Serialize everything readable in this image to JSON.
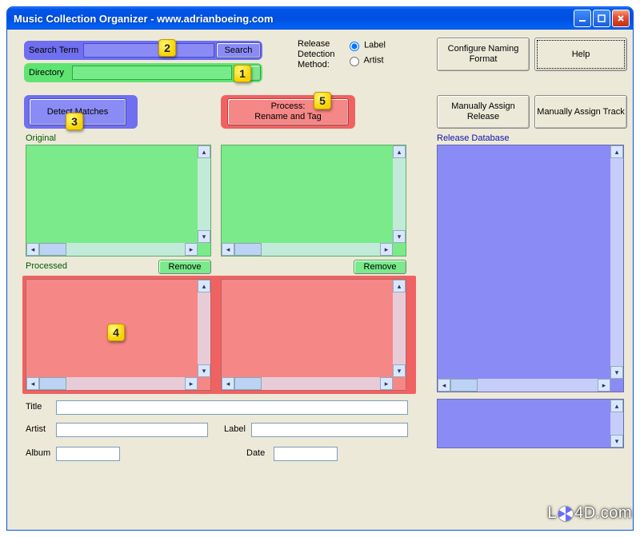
{
  "window": {
    "title": "Music Collection Organizer - www.adrianboeing.com"
  },
  "search": {
    "label": "Search Term",
    "button": "Search",
    "value": ""
  },
  "directory": {
    "label": "Directory",
    "browse": "...",
    "value": ""
  },
  "detection": {
    "label1": "Release",
    "label2": "Detection",
    "label3": "Method:",
    "option_label": "Label",
    "option_artist": "Artist",
    "selected": "label"
  },
  "buttons": {
    "configure": "Configure Naming Format",
    "help": "Help",
    "detect": "Detect Matches",
    "process_l1": "Process:",
    "process_l2": "Rename and Tag",
    "manual_release": "Manually Assign Release",
    "manual_track": "Manually Assign Track"
  },
  "panels": {
    "original": "Original",
    "processed": "Processed",
    "remove": "Remove",
    "release_db": "Release Database"
  },
  "fields": {
    "title": "Title",
    "artist": "Artist",
    "label": "Label",
    "album": "Album",
    "date": "Date"
  },
  "steps": {
    "s1": "1",
    "s2": "2",
    "s3": "3",
    "s4": "4",
    "s5": "5"
  },
  "watermark": {
    "prefix": "L",
    "suffix": "4D.com"
  }
}
